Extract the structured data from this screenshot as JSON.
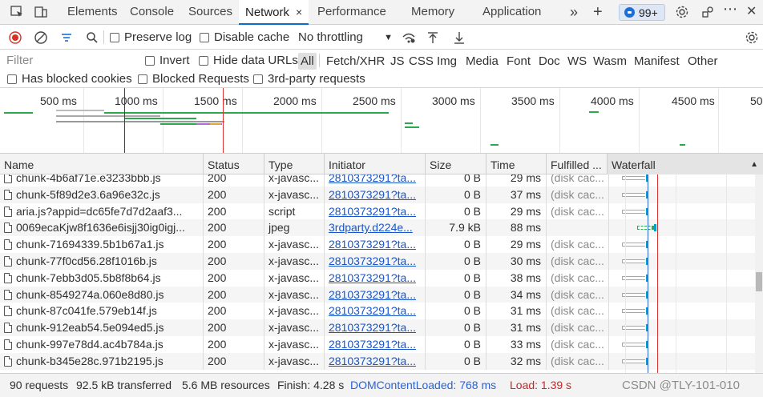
{
  "tabs": {
    "inspect_icon": "inspect-icon",
    "device_icon": "device-toolbar-icon",
    "items": [
      {
        "label": "Elements"
      },
      {
        "label": "Console"
      },
      {
        "label": "Sources"
      },
      {
        "label": "Network",
        "close": "×"
      },
      {
        "label": "Performance"
      },
      {
        "label": "Memory"
      },
      {
        "label": "Application"
      }
    ],
    "more": "»",
    "add": "+",
    "issues_count": "99+",
    "menu": "⋯",
    "close": "✕"
  },
  "toolbar": {
    "preserve_log": "Preserve log",
    "disable_cache": "Disable cache",
    "throttling": "No throttling",
    "throttle_caret": "▼"
  },
  "filters": {
    "placeholder": "Filter",
    "invert": "Invert",
    "hide_data_urls": "Hide data URLs",
    "types": [
      "All",
      "Fetch/XHR",
      "JS",
      "CSS",
      "Img",
      "Media",
      "Font",
      "Doc",
      "WS",
      "Wasm",
      "Manifest",
      "Other"
    ],
    "has_blocked_cookies": "Has blocked cookies",
    "blocked_requests": "Blocked Requests",
    "third_party": "3rd-party requests"
  },
  "overview": {
    "ticks": [
      "500 ms",
      "1000 ms",
      "1500 ms",
      "2000 ms",
      "2500 ms",
      "3000 ms",
      "3500 ms",
      "4000 ms",
      "4500 ms",
      "50"
    ]
  },
  "columns": {
    "name": "Name",
    "status": "Status",
    "type": "Type",
    "initiator": "Initiator",
    "size": "Size",
    "time": "Time",
    "fulfilled": "Fulfilled ...",
    "waterfall": "Waterfall",
    "sort_arrow": "▲"
  },
  "rows": [
    {
      "name": "chunk-4b6af71e.e3233bbb.js",
      "status": "200",
      "type": "x-javasc...",
      "initiator": "2810373291?ta...",
      "size": "0 B",
      "time": "29 ms",
      "fulfilled": "(disk cac...",
      "wf_start": 0.09,
      "wf_end": 0.25
    },
    {
      "name": "chunk-5f89d2e3.6a96e32c.js",
      "status": "200",
      "type": "x-javasc...",
      "initiator": "2810373291?ta...",
      "size": "0 B",
      "time": "37 ms",
      "fulfilled": "(disk cac...",
      "wf_start": 0.09,
      "wf_end": 0.25
    },
    {
      "name": "aria.js?appid=dc65fe7d7d2aaf3...",
      "status": "200",
      "type": "script",
      "initiator": "2810373291?ta...",
      "size": "0 B",
      "time": "29 ms",
      "fulfilled": "(disk cac...",
      "wf_start": 0.09,
      "wf_end": 0.25
    },
    {
      "name": "0069ecaKjw8f1636e6isjj30ig0igj...",
      "status": "200",
      "type": "jpeg",
      "initiator": "3rdparty.d224e...",
      "size": "7.9 kB",
      "time": "88 ms",
      "fulfilled": "",
      "wf_start": 0.19,
      "wf_end": 0.31
    },
    {
      "name": "chunk-71694339.5b1b67a1.js",
      "status": "200",
      "type": "x-javasc...",
      "initiator": "2810373291?ta...",
      "size": "0 B",
      "time": "29 ms",
      "fulfilled": "(disk cac...",
      "wf_start": 0.09,
      "wf_end": 0.25
    },
    {
      "name": "chunk-77f0cd56.28f1016b.js",
      "status": "200",
      "type": "x-javasc...",
      "initiator": "2810373291?ta...",
      "size": "0 B",
      "time": "30 ms",
      "fulfilled": "(disk cac...",
      "wf_start": 0.09,
      "wf_end": 0.25
    },
    {
      "name": "chunk-7ebb3d05.5b8f8b64.js",
      "status": "200",
      "type": "x-javasc...",
      "initiator": "2810373291?ta...",
      "size": "0 B",
      "time": "38 ms",
      "fulfilled": "(disk cac...",
      "wf_start": 0.09,
      "wf_end": 0.25
    },
    {
      "name": "chunk-8549274a.060e8d80.js",
      "status": "200",
      "type": "x-javasc...",
      "initiator": "2810373291?ta...",
      "size": "0 B",
      "time": "34 ms",
      "fulfilled": "(disk cac...",
      "wf_start": 0.09,
      "wf_end": 0.25
    },
    {
      "name": "chunk-87c041fe.579eb14f.js",
      "status": "200",
      "type": "x-javasc...",
      "initiator": "2810373291?ta...",
      "size": "0 B",
      "time": "31 ms",
      "fulfilled": "(disk cac...",
      "wf_start": 0.09,
      "wf_end": 0.25
    },
    {
      "name": "chunk-912eab54.5e094ed5.js",
      "status": "200",
      "type": "x-javasc...",
      "initiator": "2810373291?ta...",
      "size": "0 B",
      "time": "31 ms",
      "fulfilled": "(disk cac...",
      "wf_start": 0.09,
      "wf_end": 0.25
    },
    {
      "name": "chunk-997e78d4.ac4b784a.js",
      "status": "200",
      "type": "x-javasc...",
      "initiator": "2810373291?ta...",
      "size": "0 B",
      "time": "33 ms",
      "fulfilled": "(disk cac...",
      "wf_start": 0.09,
      "wf_end": 0.25
    },
    {
      "name": "chunk-b345e28c.971b2195.js",
      "status": "200",
      "type": "x-javasc...",
      "initiator": "2810373291?ta...",
      "size": "0 B",
      "time": "32 ms",
      "fulfilled": "(disk cac...",
      "wf_start": 0.09,
      "wf_end": 0.25
    }
  ],
  "status_bar": {
    "requests": "90 requests",
    "transferred": "92.5 kB transferred",
    "resources": "5.6 MB resources",
    "finish": "Finish: 4.28 s",
    "dcl": "DOMContentLoaded: 768 ms",
    "load": "Load: 1.39 s",
    "watermark": "CSDN @TLY-101-010"
  },
  "colors": {
    "accent": "#0b6ec4",
    "link": "#1a56c9",
    "dcl": "#2a62d8",
    "load": "#dd3333",
    "receive": "#05a0c8"
  }
}
